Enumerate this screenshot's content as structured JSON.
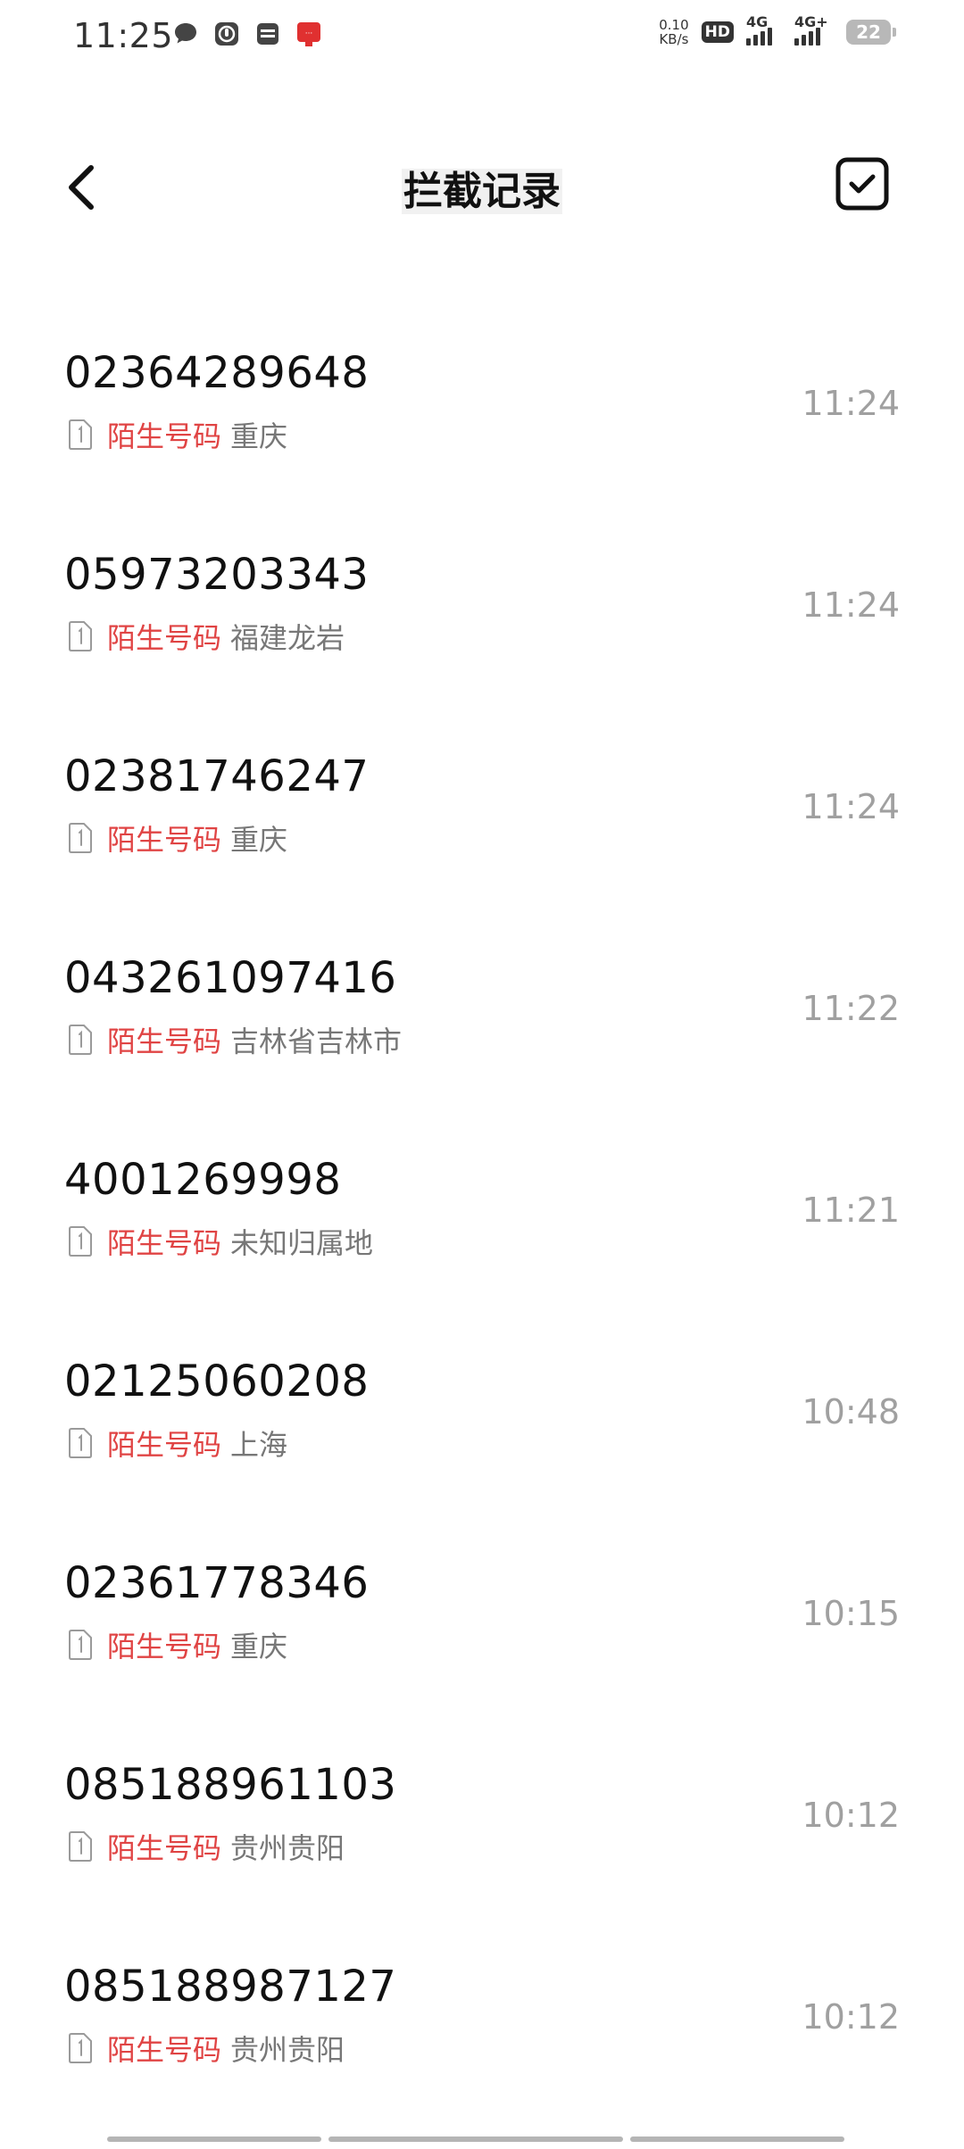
{
  "status_bar": {
    "time": "11:25",
    "net_speed_value": "0.10",
    "net_speed_unit": "KB/s",
    "hd_label": "HD",
    "sim1_label": "4G",
    "sim2_label": "4G+",
    "battery": "22"
  },
  "header": {
    "title": "拦截记录"
  },
  "records": [
    {
      "number": "02364289648",
      "tag": "陌生号码",
      "location": "重庆",
      "time": "11:24"
    },
    {
      "number": "05973203343",
      "tag": "陌生号码",
      "location": "福建龙岩",
      "time": "11:24"
    },
    {
      "number": "02381746247",
      "tag": "陌生号码",
      "location": "重庆",
      "time": "11:24"
    },
    {
      "number": "043261097416",
      "tag": "陌生号码",
      "location": "吉林省吉林市",
      "time": "11:22"
    },
    {
      "number": "4001269998",
      "tag": "陌生号码",
      "location": "未知归属地",
      "time": "11:21"
    },
    {
      "number": "02125060208",
      "tag": "陌生号码",
      "location": "上海",
      "time": "10:48"
    },
    {
      "number": "02361778346",
      "tag": "陌生号码",
      "location": "重庆",
      "time": "10:15"
    },
    {
      "number": "085188961103",
      "tag": "陌生号码",
      "location": "贵州贵阳",
      "time": "10:12"
    },
    {
      "number": "085188987127",
      "tag": "陌生号码",
      "location": "贵州贵阳",
      "time": "10:12"
    }
  ],
  "colors": {
    "tag_red": "#e04444",
    "time_gray": "#a0a0a0",
    "location_gray": "#777777"
  }
}
